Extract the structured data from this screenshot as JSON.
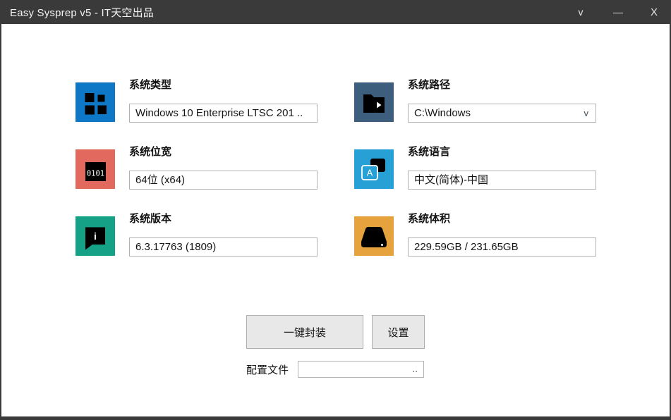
{
  "window": {
    "title": "Easy Sysprep v5 - IT天空出品",
    "dropdown_glyph": "v",
    "minimize_glyph": "—",
    "close_glyph": "X"
  },
  "fields": [
    {
      "label": "系统类型",
      "value": "Windows 10 Enterprise LTSC 201 ..",
      "color": "#0e78c6"
    },
    {
      "label": "系统路径",
      "value": "C:\\Windows",
      "color": "#3e5e7e",
      "dropdown": "v"
    },
    {
      "label": "系统位宽",
      "value": "64位 (x64)",
      "color": "#e2695e",
      "icon_text": "0101"
    },
    {
      "label": "系统语言",
      "value": "中文(简体)-中国",
      "color": "#27a0d6",
      "icon_text": "A"
    },
    {
      "label": "系统版本",
      "value": "6.3.17763 (1809)",
      "color": "#14a185",
      "icon_text": "i"
    },
    {
      "label": "系统体积",
      "value": "229.59GB / 231.65GB",
      "color": "#e6a23c"
    }
  ],
  "actions": {
    "package_label": "一键封装",
    "settings_label": "设置"
  },
  "config": {
    "label": "配置文件",
    "value": "",
    "browse_label": ".."
  }
}
